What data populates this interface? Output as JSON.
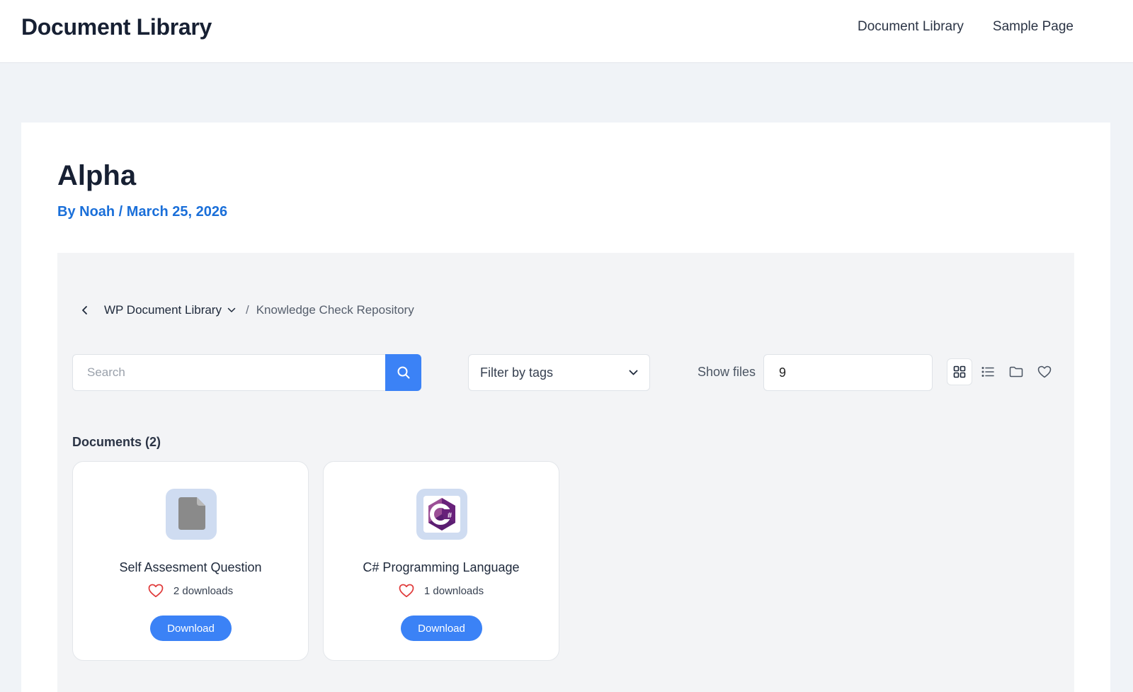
{
  "site": {
    "title": "Document Library",
    "nav": [
      "Document Library",
      "Sample Page"
    ]
  },
  "post": {
    "title": "Alpha",
    "meta": "By Noah / March 25, 2026"
  },
  "library": {
    "breadcrumb": {
      "root": "WP Document Library",
      "separator": "/",
      "current": "Knowledge Check Repository"
    },
    "search": {
      "placeholder": "Search",
      "value": ""
    },
    "tag_filter": {
      "selected": "Filter by tags"
    },
    "show_files": {
      "label": "Show files",
      "value": "9"
    },
    "view_modes": [
      "grid-view-icon",
      "list-view-icon",
      "folder-view-icon",
      "favorites-view-icon"
    ],
    "active_view": "grid",
    "documents_heading": "Documents (2)",
    "documents": [
      {
        "name": "Self Assesment Question",
        "downloads": "2 downloads",
        "icon": "file-icon",
        "button": "Download"
      },
      {
        "name": "C# Programming Language",
        "downloads": "1 downloads",
        "icon": "csharp-logo-icon",
        "button": "Download"
      }
    ]
  },
  "colors": {
    "accent": "#3b82f6",
    "meta_link": "#1a6fd9",
    "heart": "#e03a3a",
    "page_bg": "#f0f3f7"
  }
}
